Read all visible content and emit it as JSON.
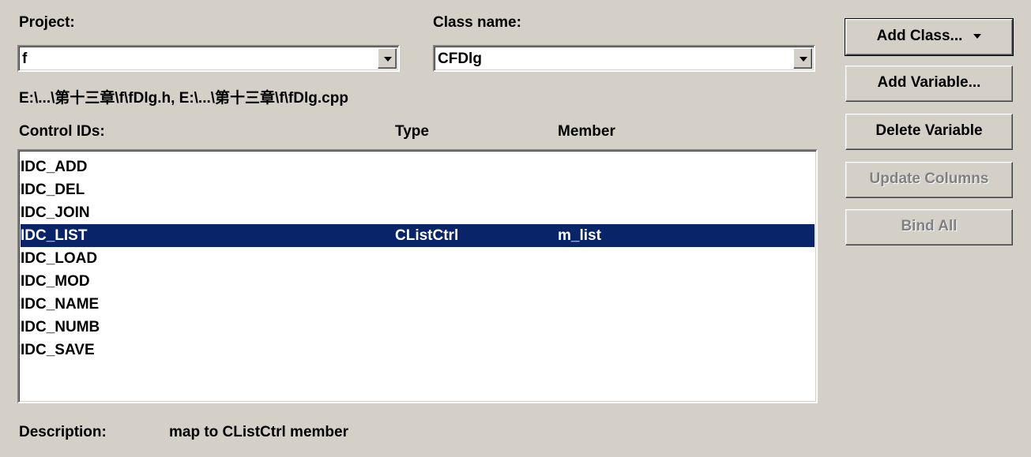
{
  "project": {
    "label": "Project:",
    "value": "f"
  },
  "class_name": {
    "label": "Class name:",
    "value": "CFDlg"
  },
  "file_path": "E:\\...\\第十三章\\f\\fDlg.h, E:\\...\\第十三章\\f\\fDlg.cpp",
  "columns": {
    "control_ids": "Control IDs:",
    "type": "Type",
    "member": "Member"
  },
  "controls": [
    {
      "id": "IDC_ADD",
      "type": "",
      "member": ""
    },
    {
      "id": "IDC_DEL",
      "type": "",
      "member": ""
    },
    {
      "id": "IDC_JOIN",
      "type": "",
      "member": ""
    },
    {
      "id": "IDC_LIST",
      "type": "CListCtrl",
      "member": "m_list",
      "selected": true
    },
    {
      "id": "IDC_LOAD",
      "type": "",
      "member": ""
    },
    {
      "id": "IDC_MOD",
      "type": "",
      "member": ""
    },
    {
      "id": "IDC_NAME",
      "type": "",
      "member": ""
    },
    {
      "id": "IDC_NUMB",
      "type": "",
      "member": ""
    },
    {
      "id": "IDC_SAVE",
      "type": "",
      "member": ""
    }
  ],
  "description": {
    "label": "Description:",
    "text": "map to CListCtrl member"
  },
  "buttons": {
    "add_class": "Add Class...",
    "add_variable": "Add Variable...",
    "delete_variable": "Delete Variable",
    "update_columns": "Update Columns",
    "bind_all": "Bind All"
  },
  "colors": {
    "selection": "#0a246a",
    "face": "#d4d0c8",
    "disabled_text": "#808080"
  }
}
